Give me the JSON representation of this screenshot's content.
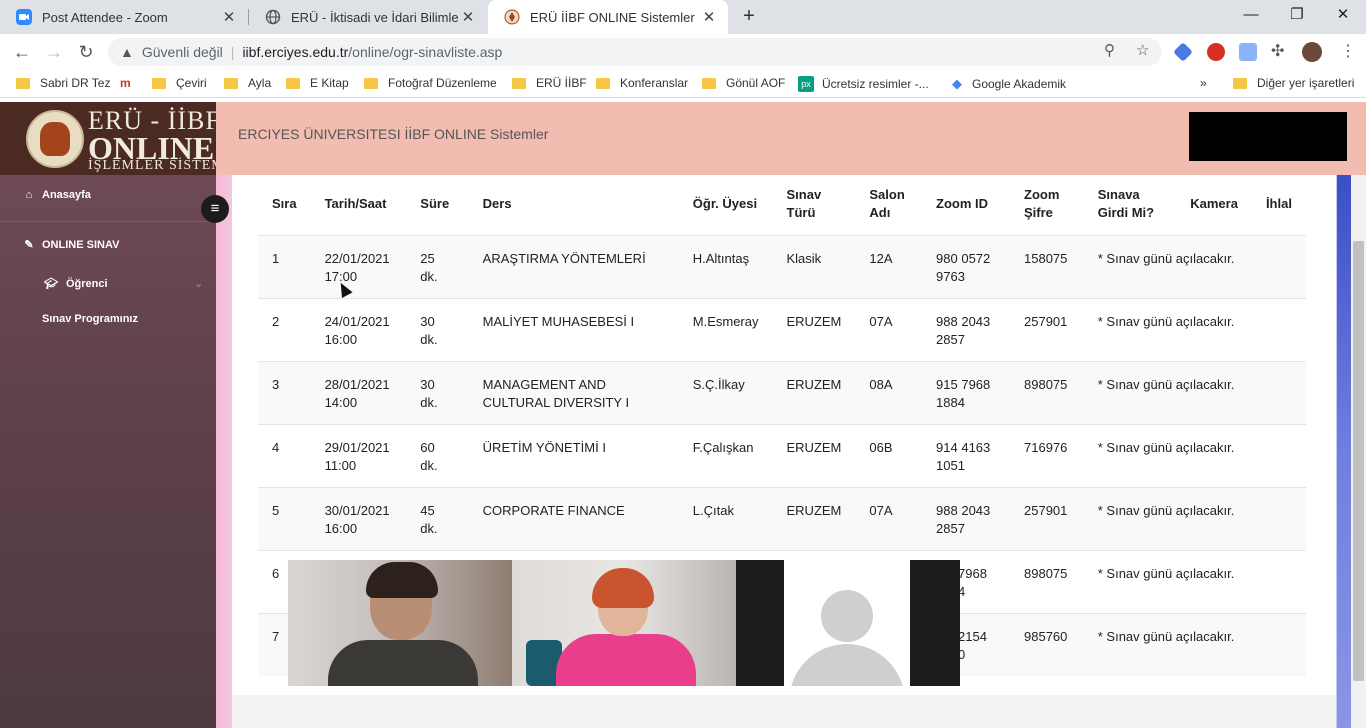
{
  "browser": {
    "tabs": [
      {
        "title": "Post Attendee - Zoom",
        "icon": "zoom-icon"
      },
      {
        "title": "ERÜ - İktisadi ve İdari Bilimler Fak",
        "icon": "globe-icon"
      },
      {
        "title": "ERÜ İİBF ONLINE Sistemler",
        "icon": "eru-icon",
        "active": true
      }
    ],
    "address": {
      "security_label": "Güvenli değil",
      "domain": "iibf.erciyes.edu.tr",
      "path": "/online/ogr-sinavliste.asp"
    },
    "bookmarks": [
      {
        "label": "Sabri DR Tez"
      },
      {
        "label": ""
      },
      {
        "label": "Çeviri"
      },
      {
        "label": "Ayla"
      },
      {
        "label": "E Kitap"
      },
      {
        "label": "Fotoğraf Düzenleme"
      },
      {
        "label": "ERÜ İİBF"
      },
      {
        "label": "Konferanslar"
      },
      {
        "label": "Gönül AOF"
      },
      {
        "label": "Ücretsiz resimler -..."
      },
      {
        "label": "Google Akademik"
      },
      {
        "label": "Diğer yer işaretleri"
      }
    ],
    "colors": {
      "tabstrip": "#dee1e6",
      "folder": "#f6c744"
    }
  },
  "site": {
    "logo": {
      "line1": "ERÜ - İİBF",
      "line2": "ONLINE",
      "line3": "İŞLEMLER SİSTEMİ"
    },
    "header_title": "ERCIYES ÜNIVERSITESI İİBF ONLINE Sistemler",
    "header_color": "#f2bdb0"
  },
  "sidebar": {
    "home": "Anasayfa",
    "online_exam": "ONLINE SINAV",
    "student": "Öğrenci",
    "exam_program": "Sınav Programınız"
  },
  "table": {
    "headers": [
      "Sıra",
      "Tarih/Saat",
      "Süre",
      "Ders",
      "Öğr. Üyesi",
      "Sınav Türü",
      "Salon Adı",
      "Zoom ID",
      "Zoom Şifre",
      "Sınava Girdi Mi?",
      "Kamera",
      "İhlal"
    ],
    "rows": [
      {
        "no": "1",
        "date": "22/01/2021",
        "time": "17:00",
        "duration": "25 dk.",
        "course": "ARAŞTIRMA YÖNTEMLERİ",
        "instructor": "H.Altıntaş",
        "type": "Klasik",
        "room": "12A",
        "zoom_id_1": "980 0572",
        "zoom_id_2": "9763",
        "password": "158075",
        "status": "* Sınav günü açılacakır."
      },
      {
        "no": "2",
        "date": "24/01/2021",
        "time": "16:00",
        "duration": "30 dk.",
        "course": "MALİYET MUHASEBESİ I",
        "instructor": "M.Esmeray",
        "type": "ERUZEM",
        "room": "07A",
        "zoom_id_1": "988 2043",
        "zoom_id_2": "2857",
        "password": "257901",
        "status": "* Sınav günü açılacakır."
      },
      {
        "no": "3",
        "date": "28/01/2021",
        "time": "14:00",
        "duration": "30 dk.",
        "course": "MANAGEMENT AND CULTURAL DIVERSITY I",
        "instructor": "S.Ç.İlkay",
        "type": "ERUZEM",
        "room": "08A",
        "zoom_id_1": "915 7968",
        "zoom_id_2": "1884",
        "password": "898075",
        "status": "* Sınav günü açılacakır."
      },
      {
        "no": "4",
        "date": "29/01/2021",
        "time": "11:00",
        "duration": "60 dk.",
        "course": "ÜRETİM YÖNETİMİ I",
        "instructor": "F.Çalışkan",
        "type": "ERUZEM",
        "room": "06B",
        "zoom_id_1": "914 4163",
        "zoom_id_2": "1051",
        "password": "716976",
        "status": "* Sınav günü açılacakır."
      },
      {
        "no": "5",
        "date": "30/01/2021",
        "time": "16:00",
        "duration": "45 dk.",
        "course": "CORPORATE FINANCE",
        "instructor": "L.Çıtak",
        "type": "ERUZEM",
        "room": "07A",
        "zoom_id_1": "988 2043",
        "zoom_id_2": "2857",
        "password": "257901",
        "status": "* Sınav günü açılacakır."
      },
      {
        "no": "6",
        "date": "",
        "time": "",
        "duration": "",
        "course": "",
        "instructor": "",
        "type": "",
        "room": "",
        "zoom_id_1": "7968",
        "zoom_id_2": "4",
        "password": "898075",
        "status": "* Sınav günü açılacakır."
      },
      {
        "no": "7",
        "date": "",
        "time": "",
        "duration": "",
        "course": "",
        "instructor": "",
        "type": "",
        "room": "",
        "zoom_id_1": "2154",
        "zoom_id_2": "0",
        "password": "985760",
        "status": "* Sınav günü açılacakır."
      }
    ]
  }
}
